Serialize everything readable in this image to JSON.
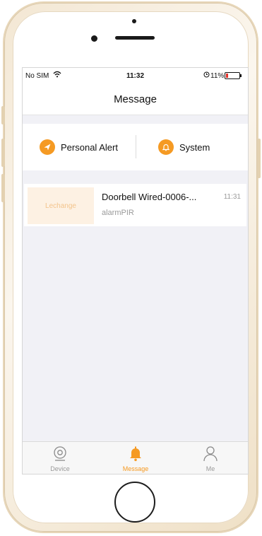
{
  "statusbar": {
    "carrier": "No SIM",
    "time": "11:32",
    "battery_percent": "11%",
    "battery_level": 0.11
  },
  "navbar": {
    "title": "Message"
  },
  "tabs": [
    {
      "label": "Personal Alert",
      "icon": "send-icon"
    },
    {
      "label": "System",
      "icon": "bell-icon"
    }
  ],
  "messages": [
    {
      "thumbnail_text": "Lechange",
      "title": "Doorbell Wired-0006-...",
      "time": "11:31",
      "subtitle": "alarmPIR"
    }
  ],
  "tabbar": {
    "items": [
      {
        "label": "Device",
        "icon": "camera-icon",
        "active": false
      },
      {
        "label": "Message",
        "icon": "bell-icon",
        "active": true
      },
      {
        "label": "Me",
        "icon": "person-icon",
        "active": false
      }
    ]
  },
  "colors": {
    "accent": "#f59a23",
    "battery_low": "#e3322a",
    "background": "#f1f1f6"
  }
}
